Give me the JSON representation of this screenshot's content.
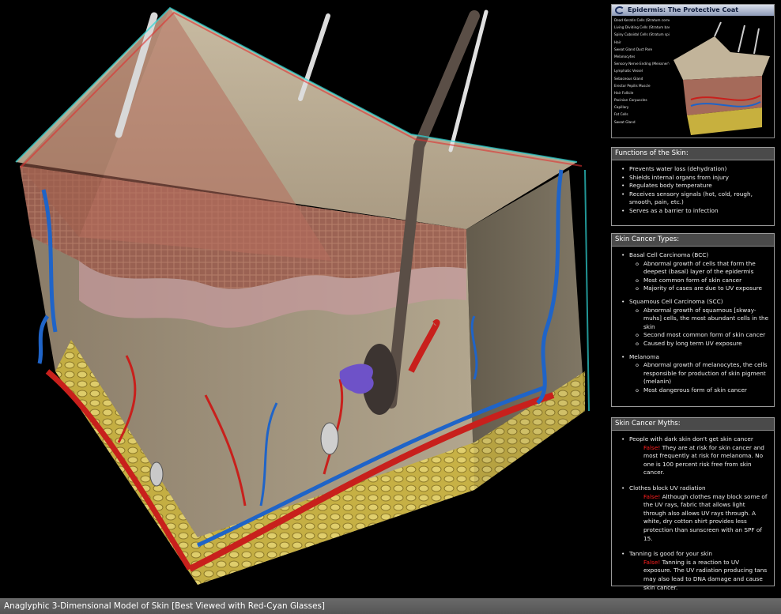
{
  "thumbnail": {
    "title": "Epidermis: The Protective Coat",
    "labels": [
      "Dead Keratin Cells (Stratum corneum)",
      "Living Dividing Cells (Stratum basale)",
      "Spiny Cuboidal Cells (Stratum spinosum)",
      "Hair",
      "Sweat Gland Duct Pore",
      "Melanocytes",
      "Sensory Nerve Ending (Meissner's corpuscle)",
      "Lymphatic Vessel",
      "Sebaceous Gland",
      "Erector Pepilis Muscle",
      "Hair Follicle",
      "Pacinian Corpuscles",
      "Capillary",
      "Fat Cells",
      "Sweat Gland"
    ]
  },
  "functions": {
    "title": "Functions of the Skin:",
    "items": [
      "Prevents water loss (dehydration)",
      "Shields internal organs from injury",
      "Regulates body temperature",
      "Receives sensory signals (hot, cold, rough, smooth, pain, etc.)",
      "Serves as a barrier to infection"
    ]
  },
  "types": {
    "title": "Skin Cancer Types:",
    "items": [
      {
        "name": "Basal Cell Carcinoma (BCC)",
        "points": [
          "Abnormal growth of cells that form the deepest (basal) layer of the epidermis",
          "Most common form of skin cancer",
          "Majority of cases are due to UV exposure"
        ]
      },
      {
        "name": "Squamous Cell Carcinoma (SCC)",
        "points": [
          "Abnormal growth of squamous [skway-muhs] cells, the most abundant cells in the skin",
          "Second most common form of skin cancer",
          "Caused by long term UV exposure"
        ]
      },
      {
        "name": "Melanoma",
        "points": [
          "Abnormal growth of melanocytes, the cells responsible for production of skin pigment (melanin)",
          "Most dangerous form of skin cancer"
        ]
      }
    ]
  },
  "myths": {
    "title": "Skin Cancer Myths:",
    "items": [
      {
        "myth": "People with dark skin don't get skin cancer",
        "false_label": "False!",
        "answer": "They are at risk for skin cancer and most frequently at risk for melanoma. No one is 100 percent risk free from skin cancer."
      },
      {
        "myth": "Clothes block UV radiation",
        "false_label": "False!",
        "answer": "Although clothes may block some of the UV rays, fabric that allows light through also allows UV rays through. A white, dry cotton shirt provides less protection than sunscreen with an SPF of 15."
      },
      {
        "myth": "Tanning is good for your skin",
        "false_label": "False!",
        "answer": "Tanning is a reaction to UV exposure. The UV radiation producing tans may also lead to DNA damage and cause skin cancer."
      }
    ]
  },
  "caption": "Anaglyphic 3-Dimensional Model of Skin [Best Viewed with Red-Cyan Glasses]",
  "colors": {
    "panel_header": "#4a4a4a",
    "false_text": "#ff1e1e",
    "artery": "#c8201c",
    "vein": "#1f64c8",
    "fat": "#d8c24a"
  }
}
